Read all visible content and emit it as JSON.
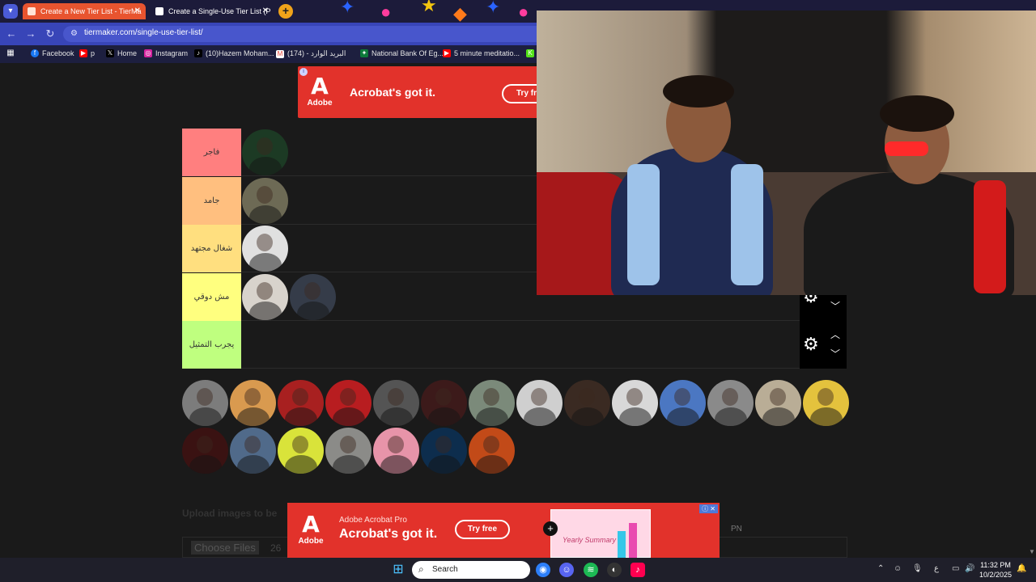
{
  "browser": {
    "tabs": [
      {
        "title": "Create a New Tier List - TierMa",
        "active": true
      },
      {
        "title": "Create a Single-Use Tier List (P",
        "active": false
      }
    ],
    "url": "tiermaker.com/single-use-tier-list/",
    "bookmarks": [
      {
        "label": "Facebook",
        "icon": "facebook-icon",
        "color": "#1877f2"
      },
      {
        "label": "p",
        "icon": "youtube-icon",
        "color": "#ff0000"
      },
      {
        "label": "Home",
        "icon": "x-icon",
        "color": "#000000"
      },
      {
        "label": "Instagram",
        "icon": "instagram-icon",
        "color": "#d6249f"
      },
      {
        "label": "(10)Hazem Moham...",
        "icon": "tiktok-icon",
        "color": "#000000"
      },
      {
        "label": "(174) - البريد الوارد",
        "icon": "gmail-icon",
        "color": "#ea4335"
      },
      {
        "label": "National Bank Of Eg...",
        "icon": "bank-icon",
        "color": "#0d7a3a"
      },
      {
        "label": "5 minute meditatio...",
        "icon": "youtube-icon",
        "color": "#ff0000"
      }
    ]
  },
  "ads": {
    "top": {
      "brand": "Adobe",
      "headline": "Acrobat's got it.",
      "cta": "Try fr"
    },
    "bottom": {
      "brand": "Adobe",
      "product": "Adobe Acrobat Pro",
      "headline": "Acrobat's got it.",
      "cta": "Try free",
      "preview_title": "Yearly Summary"
    }
  },
  "tiers": [
    {
      "label": "فاجر",
      "color": "#ff7f7f",
      "items": [
        {
          "bg": "#1c3a24"
        }
      ]
    },
    {
      "label": "جامد",
      "color": "#ffbf7f",
      "items": [
        {
          "bg": "#6d6a55"
        }
      ]
    },
    {
      "label": "شغال مجتهد",
      "color": "#ffdf7f",
      "items": [
        {
          "bg": "#e0e0e0"
        }
      ]
    },
    {
      "label": "مش دوقي",
      "color": "#ffff7f",
      "items": [
        {
          "bg": "#d8d3cc"
        },
        {
          "bg": "#353c49"
        }
      ]
    },
    {
      "label": "يجرب التمثيل",
      "color": "#bfff7f",
      "items": []
    }
  ],
  "pool": [
    [
      {
        "bg": "#7c7c7c"
      },
      {
        "bg": "#d99a4f"
      },
      {
        "bg": "#a82020"
      },
      {
        "bg": "#b81d20"
      },
      {
        "bg": "#545454"
      },
      {
        "bg": "#3c1a1a"
      },
      {
        "bg": "#7b8a7a"
      },
      {
        "bg": "#cfcfcf"
      },
      {
        "bg": "#3a2a22"
      },
      {
        "bg": "#d8d8d8"
      },
      {
        "bg": "#4b77c2"
      },
      {
        "bg": "#8a8a8a"
      },
      {
        "bg": "#b9ad96"
      },
      {
        "bg": "#e4c23d"
      }
    ],
    [
      {
        "bg": "#3a1212"
      },
      {
        "bg": "#506a8a"
      },
      {
        "bg": "#d9e33a"
      },
      {
        "bg": "#8b8b88"
      },
      {
        "bg": "#e794a9"
      },
      {
        "bg": "#0d2d4d"
      },
      {
        "bg": "#c24a18"
      }
    ]
  ],
  "upload": {
    "title": "Upload images to be",
    "button": "Choose Files",
    "count": "26",
    "extra": "PN"
  },
  "taskbar": {
    "search": "Search",
    "time": "11:32 PM",
    "date": "10/2/2025",
    "lang": "ع"
  },
  "colors": {
    "accent": "#e8542f",
    "addressbar": "#3845b8"
  }
}
